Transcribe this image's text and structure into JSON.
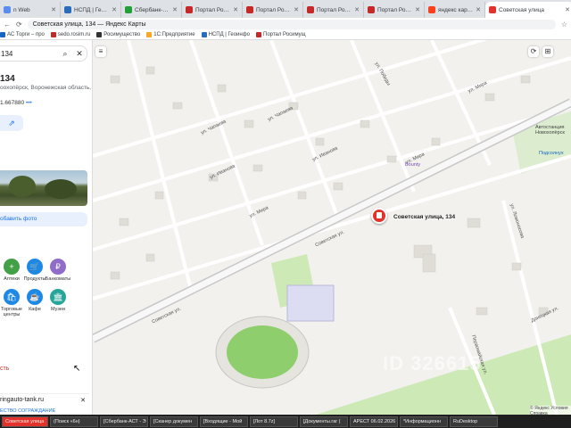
{
  "browser": {
    "tabs": [
      {
        "label": "n Web",
        "color": "#5b8def"
      },
      {
        "label": "НСПД | Геоинформ",
        "color": "#2a6ebb"
      },
      {
        "label": "Сбербанк-АСТ - Эл",
        "color": "#21a038"
      },
      {
        "label": "Портал Росимущ",
        "color": "#c62828"
      },
      {
        "label": "Портал Росимущ",
        "color": "#c62828"
      },
      {
        "label": "Портал Росимущ",
        "color": "#c62828"
      },
      {
        "label": "Портал Росимущ",
        "color": "#c62828"
      },
      {
        "label": "яндекс карта — Я",
        "color": "#fc3f1d"
      },
      {
        "label": "Советская улица",
        "color": "#e3322b",
        "active": true
      }
    ],
    "tab_close": "✕",
    "new_tab": "+",
    "window_controls": [
      "—",
      "❐",
      "✕"
    ],
    "url": "Советская улица, 134 — Яндекс Карты",
    "bookmarks": [
      {
        "label": "АС Торги – про",
        "color": "#1565c0"
      },
      {
        "label": "sedo.rosim.ru",
        "color": "#c62828"
      },
      {
        "label": "Росимущество",
        "color": "#333333"
      },
      {
        "label": "1С:Предприятие",
        "color": "#f9a825"
      },
      {
        "label": "НСПД | Геоинфо",
        "color": "#2a6ebb"
      },
      {
        "label": "Портал Росимущ",
        "color": "#c62828"
      }
    ]
  },
  "panel": {
    "search_value": "134",
    "title": "134",
    "subtitle": "оохопёрск, Воронежская область,",
    "coords": "1.667880",
    "coords_more": "•••",
    "share_icon": "⇗",
    "add_photo": "обавить фото",
    "categories": [
      {
        "label": "Аптеки",
        "icon": "+",
        "color": "#43a047"
      },
      {
        "label": "Продукты",
        "icon": "🛒",
        "color": "#1e88e5"
      },
      {
        "label": "Банкоматы",
        "icon": "₽",
        "color": "#8e6cc8"
      },
      {
        "label": "",
        "icon": "",
        "color": "#ffffff"
      },
      {
        "label": "Торговые центры",
        "icon": "🛍",
        "color": "#1e88e5"
      },
      {
        "label": "Кафе",
        "icon": "☕",
        "color": "#1e88e5"
      },
      {
        "label": "Музеи",
        "icon": "🏛",
        "color": "#26a69a"
      }
    ],
    "red_link": "сть",
    "web_link": "ringauto-tank.ru",
    "web_link_close": "✕",
    "footer_note": "ЕСТВО СОГРАЖДАНИЕ"
  },
  "map": {
    "streets": [
      "Советская ул.",
      "Советская ул.",
      "ул. Мира",
      "ул. Чапаева",
      "ул. Чапаева",
      "ул. Иванова",
      "ул. Иванова",
      "ул. Мира",
      "ул. Мира",
      "ул. Победы",
      "ул. Ломоносова",
      "Донецкая ул.",
      "Первомайская ул."
    ],
    "places": [
      "Bounty",
      "Подсолнух",
      "Автостанция Новохопёрск"
    ],
    "pin_label": "Советская улица, 134",
    "watermark": "ID 326615",
    "copyright": "© Яндекс Условия Справка",
    "tools": [
      "≡",
      "⟳",
      "⊞"
    ]
  },
  "taskbar": [
    {
      "label": "Советская улица",
      "active": true
    },
    {
      "label": "(Поиск «6н)",
      "active": false
    },
    {
      "label": "[Сбербанк-АСТ - Э",
      "active": false
    },
    {
      "label": "[Сканер докумен",
      "active": false
    },
    {
      "label": "[Входящие - Мой",
      "active": false
    },
    {
      "label": "[Лот 8.7z]",
      "active": false
    },
    {
      "label": "[Документы.rar (",
      "active": false
    },
    {
      "label": "АРЕСТ 06.02.2026",
      "active": false
    },
    {
      "label": "*Информационн",
      "active": false
    },
    {
      "label": "RuDesktop",
      "active": false
    }
  ]
}
